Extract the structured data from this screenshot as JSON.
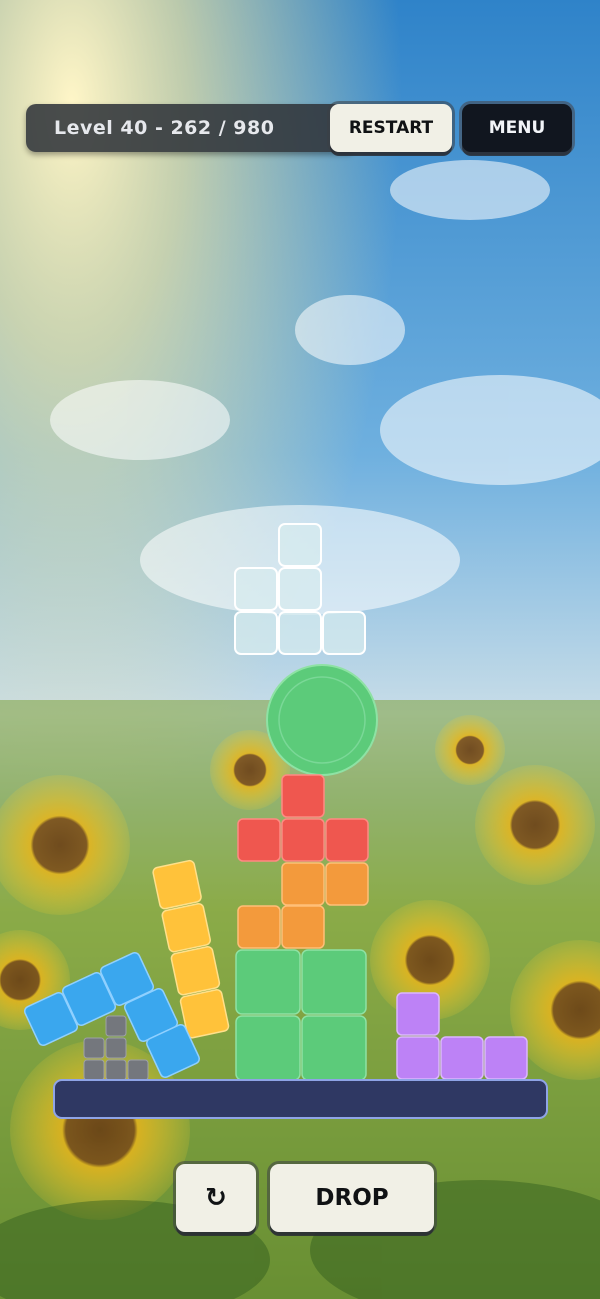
{
  "hud": {
    "level_text": "Level 40 - 262 / 980",
    "restart_label": "RESTART",
    "menu_label": "MENU"
  },
  "controls": {
    "rotate_icon": "↻",
    "drop_label": "DROP"
  },
  "colors": {
    "falling_piece": "#d7ecee",
    "green": "#5ccb7a",
    "red": "#ef574f",
    "orange": "#f39a3c",
    "yellow": "#ffc23a",
    "blue": "#3aa7ee",
    "purple": "#bd82f6",
    "grey": "#74777d",
    "platform": "#2f3863"
  },
  "icons": [
    "rotate-icon"
  ]
}
